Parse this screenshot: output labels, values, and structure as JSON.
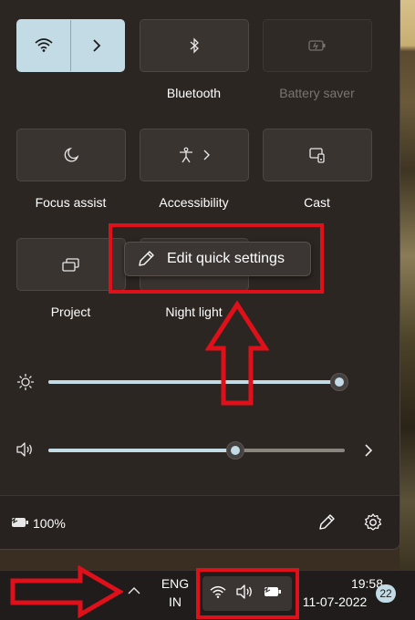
{
  "quick_settings": {
    "tiles": {
      "bluetooth": "Bluetooth",
      "battery_saver": "Battery saver",
      "focus_assist": "Focus assist",
      "accessibility": "Accessibility",
      "cast": "Cast",
      "project": "Project",
      "night_light": "Night light"
    },
    "tooltip": "Edit quick settings",
    "brightness_level": 0.98,
    "volume_level": 0.63
  },
  "footer": {
    "battery_percent": "100%"
  },
  "taskbar": {
    "lang_top": "ENG",
    "lang_bottom": "IN",
    "time": "19:58",
    "date": "11-07-2022",
    "notification_count": "22"
  },
  "colors": {
    "accent": "#c3dbe4",
    "annotation_red": "#e0101a",
    "panel_bg": "#2c2622"
  },
  "icons": [
    "wifi-icon",
    "chevron-right-icon",
    "bluetooth-icon",
    "battery-saver-icon",
    "moon-icon",
    "accessibility-icon",
    "cast-icon",
    "project-icon",
    "pencil-icon",
    "brightness-icon",
    "volume-icon",
    "battery-icon",
    "settings-gear-icon",
    "chevron-up-icon"
  ]
}
